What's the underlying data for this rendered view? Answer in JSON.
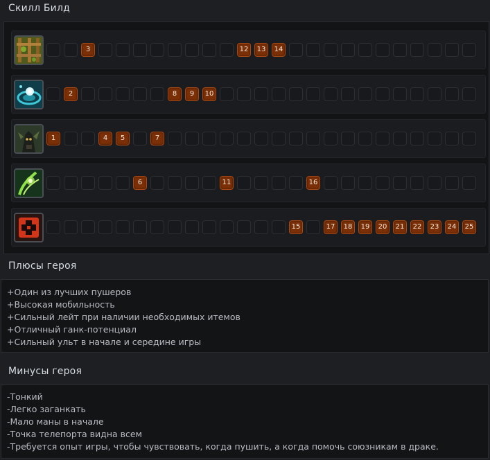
{
  "skill_build": {
    "title": "Скилл Билд",
    "rows": [
      {
        "icon": "sprout-icon",
        "levels": [
          3,
          12,
          13,
          14
        ]
      },
      {
        "icon": "teleport-icon",
        "levels": [
          2,
          8,
          9,
          10
        ]
      },
      {
        "icon": "treant-icon",
        "levels": [
          1,
          4,
          5,
          7
        ]
      },
      {
        "icon": "nature-call-icon",
        "levels": [
          6,
          11,
          16
        ]
      },
      {
        "icon": "attribute-bonus-icon",
        "levels": [
          15,
          17,
          18,
          19,
          20,
          21,
          22,
          23,
          24,
          25
        ]
      }
    ]
  },
  "pros": {
    "title": "Плюсы героя",
    "items": [
      "+Один из лучших пушеров",
      "+Высокая мобильность",
      "+Сильный лейт при наличии необходимых итемов",
      "+Отличный ганк-потенциал",
      "+Сильный ульт в начале и середине игры"
    ]
  },
  "cons": {
    "title": "Минусы героя",
    "items": [
      "-Тонкий",
      "-Легко заганкать",
      "-Мало маны в начале",
      "-Точка телепорта видна всем",
      "-Требуется опыт игры, чтобы чувствовать, когда пушить, а когда помочь союзникам в драке."
    ]
  },
  "colors": {
    "level_cell": "#7a2f06",
    "empty_cell": "#18191c",
    "panel": "#131416",
    "title_text": "#d7dce2"
  }
}
